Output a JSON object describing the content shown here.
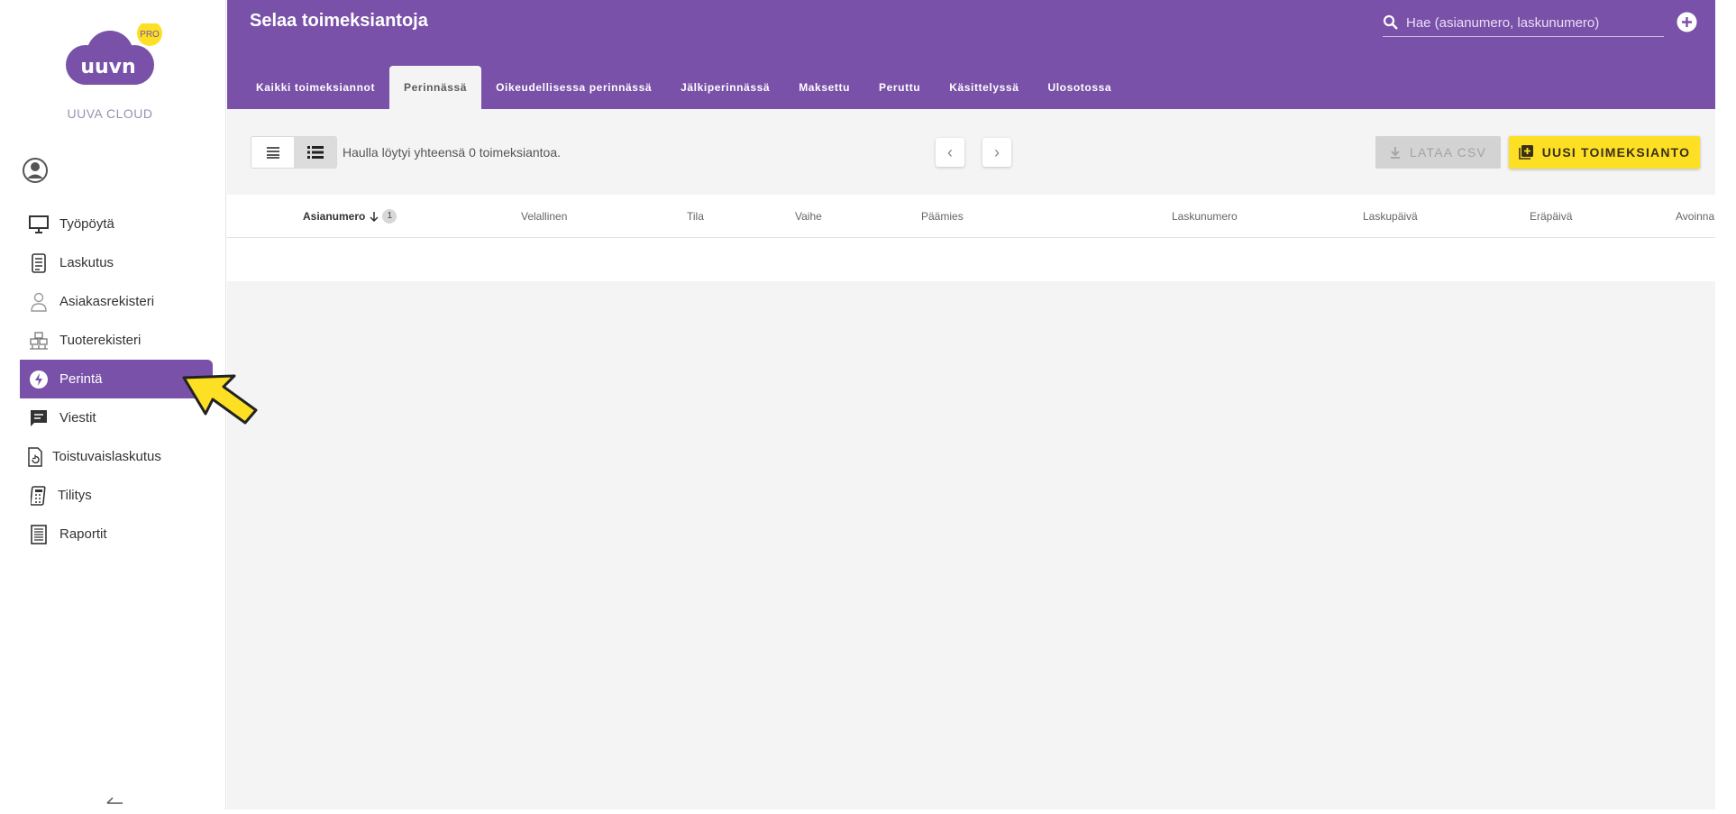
{
  "brand": {
    "logo_text": "uuvn",
    "badge": "PRO",
    "name": "UUVA CLOUD"
  },
  "sidebar": {
    "items": [
      {
        "label": "Työpöytä",
        "icon": "monitor-icon",
        "active": false
      },
      {
        "label": "Laskutus",
        "icon": "invoice-icon",
        "active": false
      },
      {
        "label": "Asiakasrekisteri",
        "icon": "person-icon",
        "active": false
      },
      {
        "label": "Tuoterekisteri",
        "icon": "product-stack-icon",
        "active": false
      },
      {
        "label": "Perintä",
        "icon": "lightning-circle-icon",
        "active": true
      },
      {
        "label": "Viestit",
        "icon": "message-icon",
        "active": false
      },
      {
        "label": "Toistuvaislaskutus",
        "icon": "recurring-document-icon",
        "active": false
      },
      {
        "label": "Tilitys",
        "icon": "calculator-icon",
        "active": false
      },
      {
        "label": "Raportit",
        "icon": "report-icon",
        "active": false
      }
    ]
  },
  "header": {
    "title": "Selaa toimeksiantoja",
    "search_placeholder": "Hae (asianumero, laskunumero)",
    "tabs": [
      {
        "label": "Kaikki toimeksiannot",
        "active": false
      },
      {
        "label": "Perinnässä",
        "active": true
      },
      {
        "label": "Oikeudellisessa perinnässä",
        "active": false
      },
      {
        "label": "Jälkiperinnässä",
        "active": false
      },
      {
        "label": "Maksettu",
        "active": false
      },
      {
        "label": "Peruttu",
        "active": false
      },
      {
        "label": "Käsittelyssä",
        "active": false
      },
      {
        "label": "Ulosotossa",
        "active": false
      }
    ]
  },
  "toolbar": {
    "result_text": "Haulla löytyi yhteensä 0 toimeksiantoa.",
    "csv_label": "LATAA CSV",
    "new_label": "UUSI TOIMEKSIANTO",
    "prev_glyph": "‹",
    "next_glyph": "›"
  },
  "table": {
    "columns": [
      "Asianumero",
      "Velallinen",
      "Tila",
      "Vaihe",
      "Päämies",
      "Laskunumero",
      "Laskupäivä",
      "Eräpäivä",
      "Avoinna"
    ],
    "sort_column": "Asianumero",
    "sort_badge": "1",
    "rows": []
  },
  "colors": {
    "primary": "#7951a8",
    "accent_yellow": "#fde023",
    "background": "#f4f4f4"
  }
}
